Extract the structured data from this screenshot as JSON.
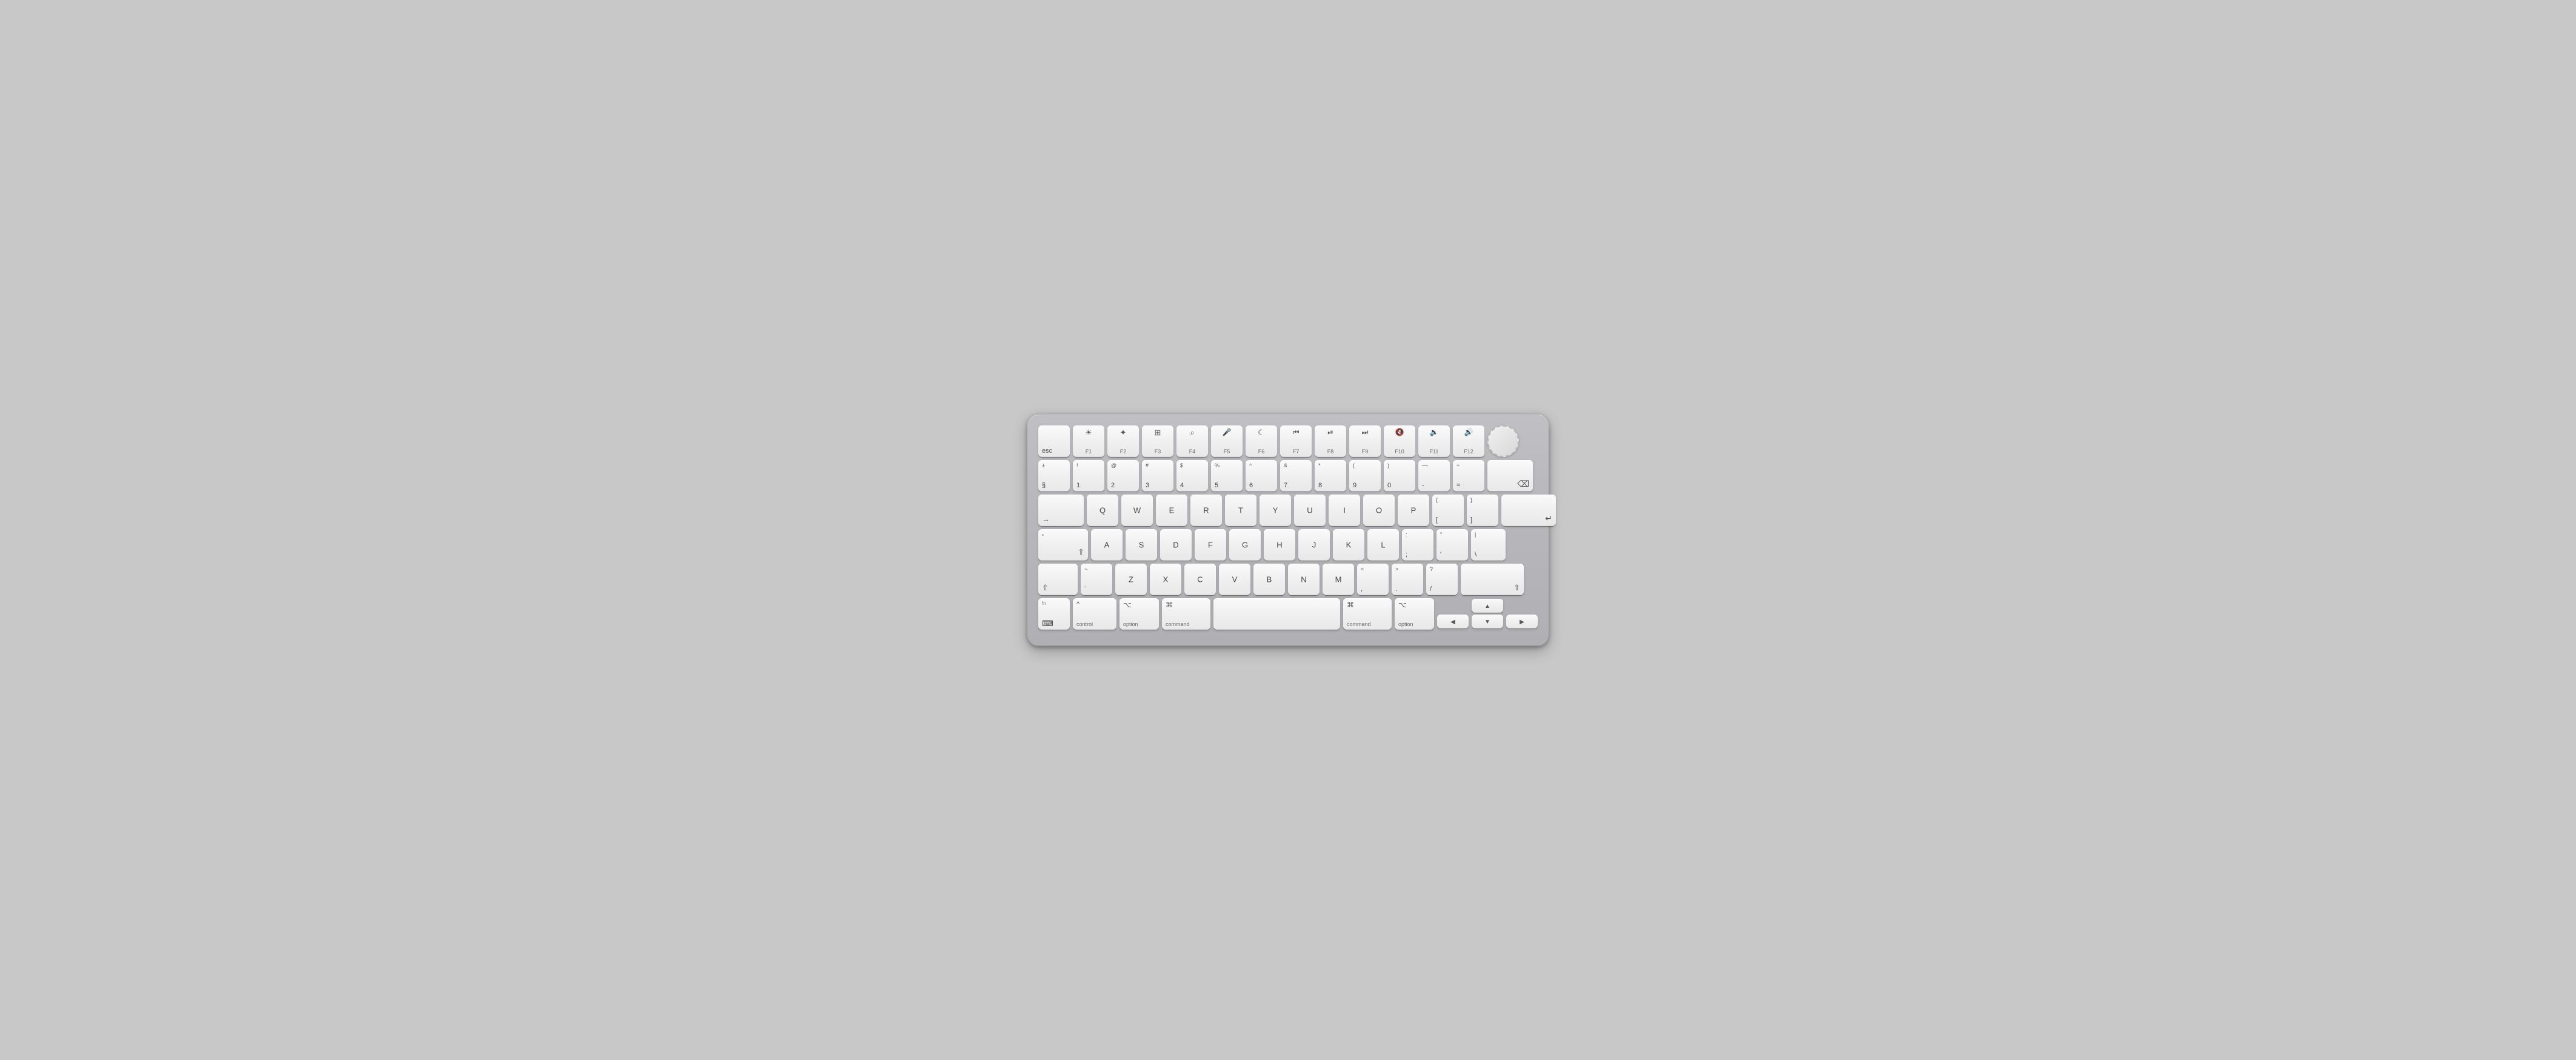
{
  "keyboard": {
    "rows": [
      {
        "id": "fn-row",
        "keys": [
          {
            "id": "esc",
            "label": "esc",
            "type": "esc"
          },
          {
            "id": "f1",
            "top": "☀",
            "bottom": "F1",
            "type": "f"
          },
          {
            "id": "f2",
            "top": "✦",
            "bottom": "F2",
            "type": "f"
          },
          {
            "id": "f3",
            "top": "⊞",
            "bottom": "F3",
            "type": "f"
          },
          {
            "id": "f4",
            "top": "⌕",
            "bottom": "F4",
            "type": "f"
          },
          {
            "id": "f5",
            "top": "🎤",
            "bottom": "F5",
            "type": "f"
          },
          {
            "id": "f6",
            "top": "☾",
            "bottom": "F6",
            "type": "f"
          },
          {
            "id": "f7",
            "top": "⏮",
            "bottom": "F7",
            "type": "f"
          },
          {
            "id": "f8",
            "top": "⏯",
            "bottom": "F8",
            "type": "f"
          },
          {
            "id": "f9",
            "top": "⏭",
            "bottom": "F9",
            "type": "f"
          },
          {
            "id": "f10",
            "top": "🔇",
            "bottom": "F10",
            "type": "f"
          },
          {
            "id": "f11",
            "top": "🔉",
            "bottom": "F11",
            "type": "f"
          },
          {
            "id": "f12",
            "top": "🔊",
            "bottom": "F12",
            "type": "f"
          },
          {
            "id": "dial",
            "type": "dial"
          }
        ]
      },
      {
        "id": "number-row",
        "keys": [
          {
            "id": "backtick",
            "top": "±",
            "bottom": "§",
            "type": "numrow"
          },
          {
            "id": "1",
            "top": "!",
            "bottom": "1",
            "type": "numrow"
          },
          {
            "id": "2",
            "top": "@",
            "bottom": "2",
            "type": "numrow"
          },
          {
            "id": "3",
            "top": "#",
            "bottom": "3",
            "type": "numrow"
          },
          {
            "id": "4",
            "top": "$",
            "bottom": "4",
            "type": "numrow"
          },
          {
            "id": "5",
            "top": "%",
            "bottom": "5",
            "type": "numrow"
          },
          {
            "id": "6",
            "top": "^",
            "bottom": "6",
            "type": "numrow"
          },
          {
            "id": "7",
            "top": "&",
            "bottom": "7",
            "type": "numrow"
          },
          {
            "id": "8",
            "top": "*",
            "bottom": "8",
            "type": "numrow"
          },
          {
            "id": "9",
            "top": "(",
            "bottom": "9",
            "type": "numrow"
          },
          {
            "id": "0",
            "top": ")",
            "bottom": "0",
            "type": "numrow"
          },
          {
            "id": "minus",
            "top": "—",
            "bottom": "-",
            "type": "numrow"
          },
          {
            "id": "equals",
            "top": "+",
            "bottom": "=",
            "type": "numrow"
          },
          {
            "id": "backspace",
            "label": "⌫",
            "type": "backspace"
          }
        ]
      },
      {
        "id": "qwerty-row",
        "keys": [
          {
            "id": "tab",
            "label": "→",
            "sub": "",
            "type": "tab"
          },
          {
            "id": "q",
            "label": "Q",
            "type": "letter"
          },
          {
            "id": "w",
            "label": "W",
            "type": "letter"
          },
          {
            "id": "e",
            "label": "E",
            "type": "letter"
          },
          {
            "id": "r",
            "label": "R",
            "type": "letter"
          },
          {
            "id": "t",
            "label": "T",
            "type": "letter"
          },
          {
            "id": "y",
            "label": "Y",
            "type": "letter"
          },
          {
            "id": "u",
            "label": "U",
            "type": "letter"
          },
          {
            "id": "i",
            "label": "I",
            "type": "letter"
          },
          {
            "id": "o",
            "label": "O",
            "type": "letter"
          },
          {
            "id": "p",
            "label": "P",
            "type": "letter"
          },
          {
            "id": "lbracket",
            "top": "{",
            "bottom": "[",
            "type": "numrow"
          },
          {
            "id": "rbracket",
            "top": "}",
            "bottom": "]",
            "type": "numrow"
          },
          {
            "id": "return",
            "label": "↵",
            "type": "return"
          }
        ]
      },
      {
        "id": "asdf-row",
        "keys": [
          {
            "id": "caps",
            "label": "⇧",
            "sub": "•",
            "type": "caps"
          },
          {
            "id": "a",
            "label": "A",
            "type": "letter"
          },
          {
            "id": "s",
            "label": "S",
            "type": "letter"
          },
          {
            "id": "d",
            "label": "D",
            "type": "letter"
          },
          {
            "id": "f",
            "label": "F",
            "type": "letter"
          },
          {
            "id": "g",
            "label": "G",
            "type": "letter"
          },
          {
            "id": "h",
            "label": "H",
            "type": "letter"
          },
          {
            "id": "j",
            "label": "J",
            "type": "letter"
          },
          {
            "id": "k",
            "label": "K",
            "type": "letter"
          },
          {
            "id": "l",
            "label": "L",
            "type": "letter"
          },
          {
            "id": "semicolon",
            "top": ":",
            "bottom": ";",
            "type": "numrow"
          },
          {
            "id": "quote",
            "top": "\"",
            "bottom": "'",
            "type": "numrow"
          },
          {
            "id": "backslash",
            "top": "|",
            "bottom": "\\",
            "type": "numrow"
          }
        ]
      },
      {
        "id": "zxcv-row",
        "keys": [
          {
            "id": "lshift",
            "label": "⇧",
            "type": "lshift"
          },
          {
            "id": "backtick2",
            "top": "~",
            "bottom": "`",
            "type": "numrow"
          },
          {
            "id": "z",
            "label": "Z",
            "type": "letter"
          },
          {
            "id": "x",
            "label": "X",
            "type": "letter"
          },
          {
            "id": "c",
            "label": "C",
            "type": "letter"
          },
          {
            "id": "v",
            "label": "V",
            "type": "letter"
          },
          {
            "id": "b",
            "label": "B",
            "type": "letter"
          },
          {
            "id": "n",
            "label": "N",
            "type": "letter"
          },
          {
            "id": "m",
            "label": "M",
            "type": "letter"
          },
          {
            "id": "comma",
            "top": "<",
            "bottom": ",",
            "type": "numrow"
          },
          {
            "id": "period",
            "top": ">",
            "bottom": ".",
            "type": "numrow"
          },
          {
            "id": "slash",
            "top": "?",
            "bottom": "/",
            "type": "numrow"
          },
          {
            "id": "rshift",
            "label": "⇧",
            "type": "rshift"
          }
        ]
      },
      {
        "id": "bottom-row",
        "keys": [
          {
            "id": "globe",
            "top": "fn",
            "bottom": "⌨",
            "type": "fn"
          },
          {
            "id": "ctrl",
            "top": "^",
            "bottom": "control",
            "type": "ctrl"
          },
          {
            "id": "lalt",
            "top": "⌥",
            "bottom": "option",
            "type": "alt"
          },
          {
            "id": "lcmd",
            "top": "⌘",
            "bottom": "command",
            "type": "cmd"
          },
          {
            "id": "space",
            "label": "",
            "type": "space"
          },
          {
            "id": "rcmd",
            "top": "⌘",
            "bottom": "command",
            "type": "rcmd"
          },
          {
            "id": "ralt",
            "top": "⌥",
            "bottom": "option",
            "type": "ralt"
          },
          {
            "id": "arrows",
            "type": "arrows"
          }
        ]
      }
    ]
  }
}
